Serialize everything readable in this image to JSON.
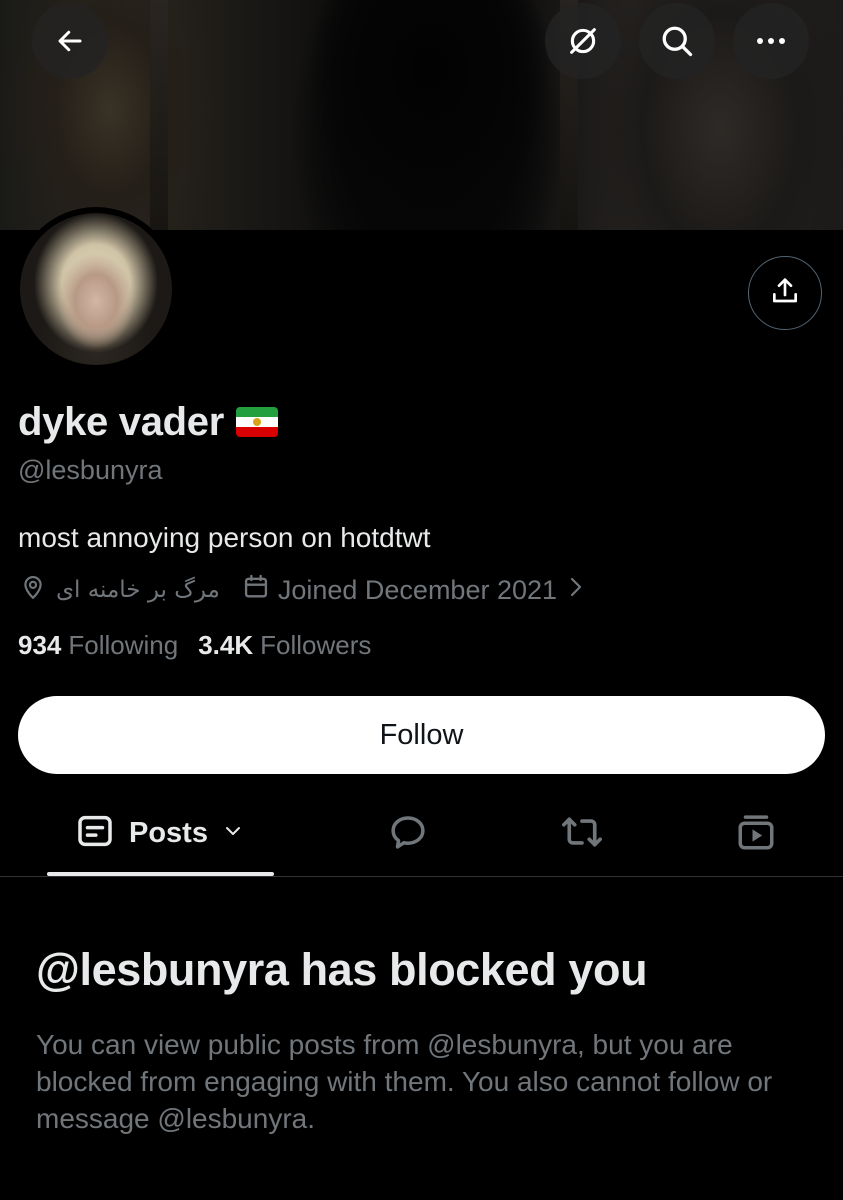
{
  "banner": {
    "description_colors": {
      "dark": "#050505",
      "warm": "#2a261f"
    }
  },
  "top_bar": {
    "back_icon": "arrow-left-icon",
    "grok_icon": "slash-circle-icon",
    "search_icon": "search-icon",
    "more_icon": "more-horizontal-icon"
  },
  "profile": {
    "display_name": "dyke vader",
    "flag_icon": "iran-lion-sun-flag",
    "handle": "@lesbunyra",
    "bio": "most annoying person on hotdtwt",
    "location": "مرگ بر خامنه ای",
    "joined": "Joined December 2021",
    "following_count": "934",
    "following_label": "Following",
    "followers_count": "3.4K",
    "followers_label": "Followers"
  },
  "actions": {
    "follow_label": "Follow",
    "share_icon": "share-icon"
  },
  "tabs": {
    "posts_label": "Posts",
    "replies_icon": "speech-bubble-icon",
    "reposts_icon": "repost-icon",
    "media_icon": "media-icon"
  },
  "blocked": {
    "title": "@lesbunyra has blocked you",
    "message": "You can view public posts from @lesbunyra, but you are blocked from engaging with them. You also cannot follow or message @lesbunyra."
  },
  "colors": {
    "background": "#000000",
    "primary_text": "#e7e9ea",
    "secondary_text": "#71767b",
    "divider": "#2f3336",
    "button_bg": "#ffffff"
  }
}
